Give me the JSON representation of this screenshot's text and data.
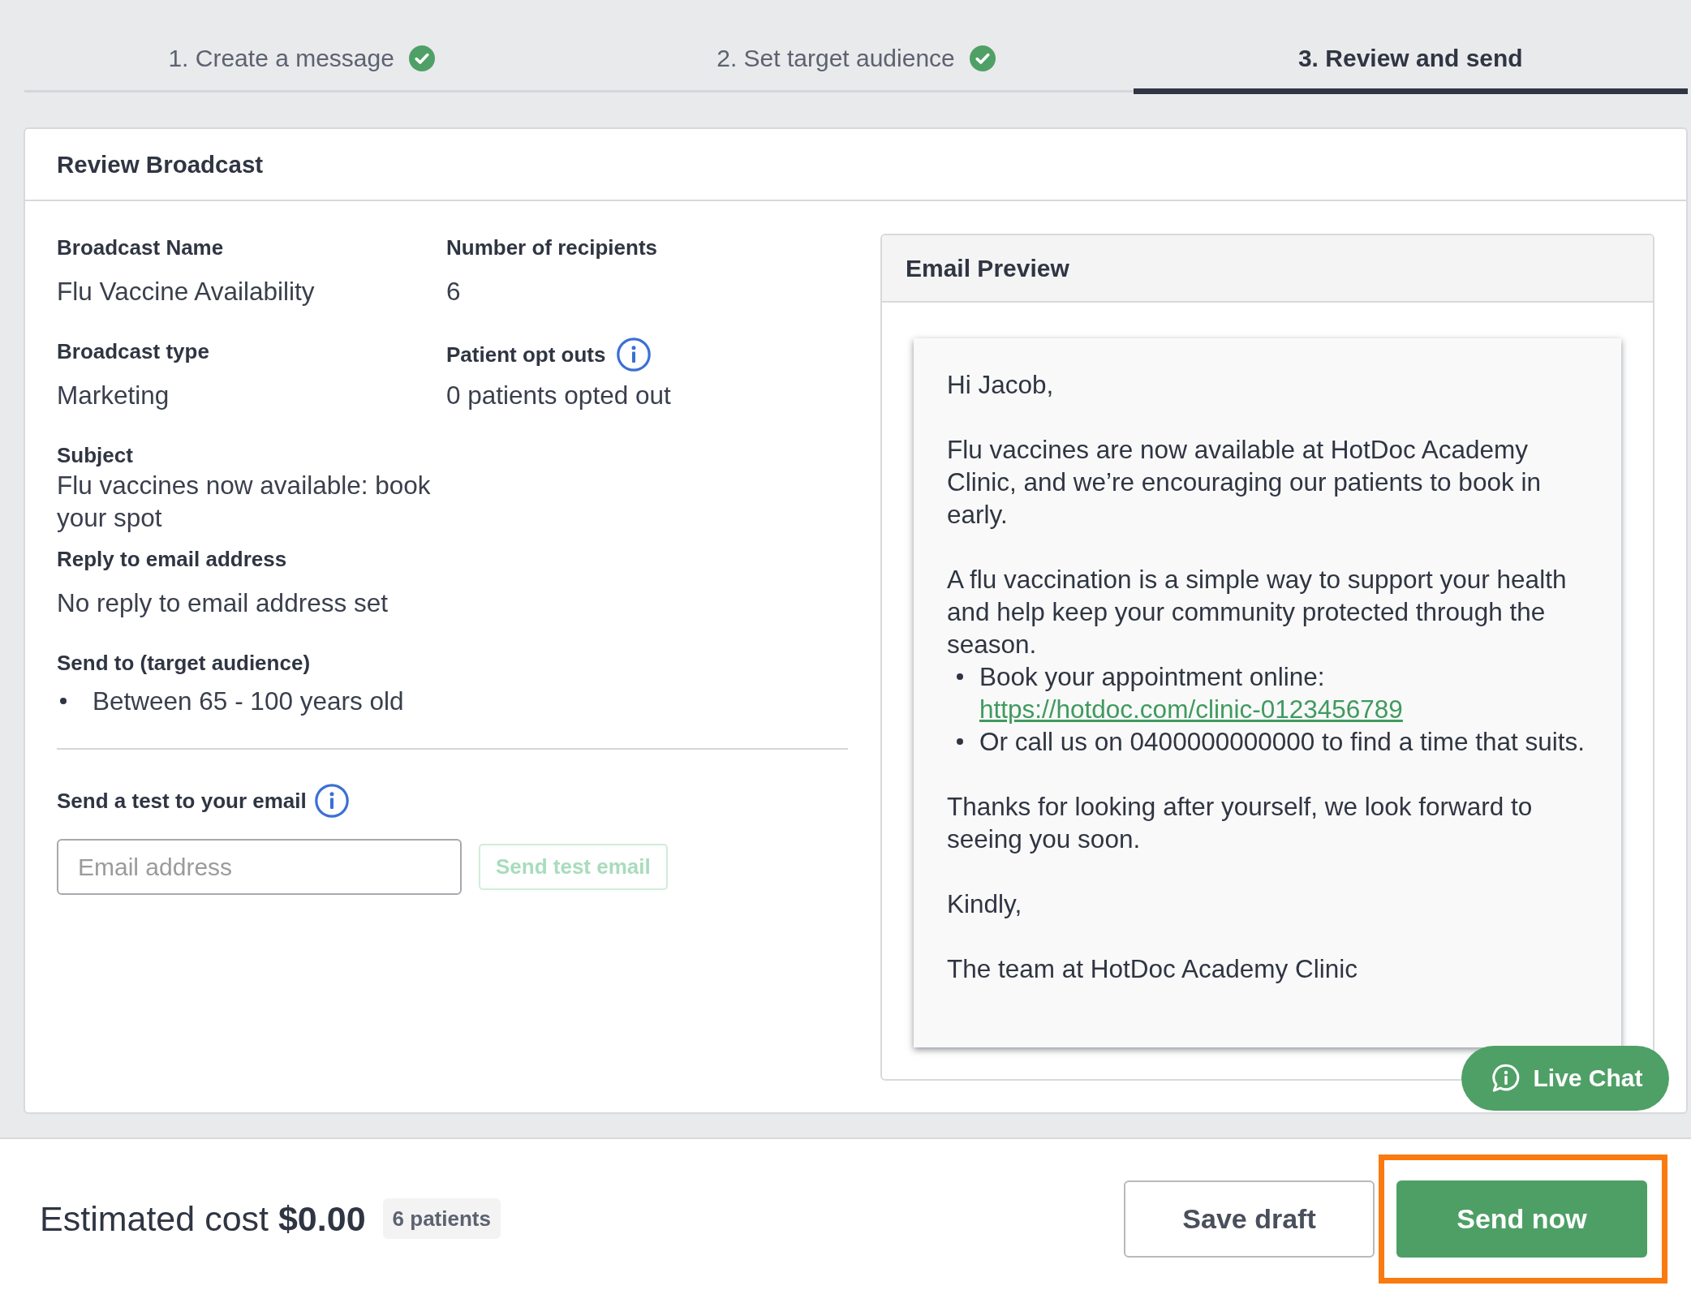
{
  "steps": [
    {
      "label": "1. Create a message",
      "completed": true,
      "selected": false
    },
    {
      "label": "2. Set target audience",
      "completed": true,
      "selected": false
    },
    {
      "label": "3. Review and send",
      "completed": false,
      "selected": true
    }
  ],
  "review": {
    "title": "Review Broadcast",
    "summary_columns": [
      [
        {
          "kind": "text",
          "label": "Broadcast Name",
          "info": false,
          "value": "Flu Vaccine Availability"
        },
        {
          "kind": "text",
          "label": "Broadcast type",
          "info": false,
          "value": "Marketing"
        },
        {
          "kind": "compact",
          "label": "Subject",
          "info": false,
          "value": "Flu vaccines now available: book your spot"
        },
        {
          "kind": "text",
          "label": "Reply to email address",
          "info": false,
          "value": "No reply to email address set"
        },
        {
          "kind": "list",
          "label": "Send to (target audience)",
          "info": false,
          "items": [
            "Between 65 - 100 years old"
          ]
        }
      ],
      [
        {
          "kind": "text",
          "label": "Number of recipients",
          "info": false,
          "value": "6"
        },
        {
          "kind": "text",
          "label": "Patient opt outs",
          "info": true,
          "value": "0 patients opted out"
        }
      ]
    ],
    "test_email": {
      "label": "Send a test to your email",
      "info": true,
      "placeholder": "Email address",
      "button": {
        "label": "Send test email",
        "disabled": true
      }
    },
    "email_preview": {
      "title": "Email Preview",
      "blocks": [
        {
          "kind": "paragraph",
          "text": "Hi Jacob,"
        },
        {
          "kind": "paragraph",
          "text": "Flu vaccines are now available at HotDoc Academy Clinic, and we’re encouraging our patients to book in early."
        },
        {
          "kind": "paragraph",
          "text": "A flu vaccination is a simple way to support your health and help keep your community protected through the season."
        },
        {
          "kind": "list",
          "items": [
            {
              "text": "Book your appointment online:",
              "link": "https://hotdoc.com/clinic-0123456789"
            },
            {
              "text": "Or call us on 0400000000000 to find a time that suits."
            }
          ]
        },
        {
          "kind": "paragraph",
          "text": "Thanks for looking after yourself, we look forward to seeing you soon."
        },
        {
          "kind": "paragraph",
          "text": "Kindly,"
        },
        {
          "kind": "paragraph",
          "text": "The team at HotDoc Academy Clinic"
        }
      ]
    }
  },
  "live_chat": {
    "label": "Live Chat"
  },
  "footer": {
    "estimated_cost": "Estimated cost **$0.00**",
    "recipients_badge": "6 patients",
    "buttons": [
      {
        "label": "Save draft",
        "kind": "secondary",
        "highlighted": false
      },
      {
        "label": "Send now",
        "kind": "primary",
        "highlighted": true
      }
    ]
  }
}
